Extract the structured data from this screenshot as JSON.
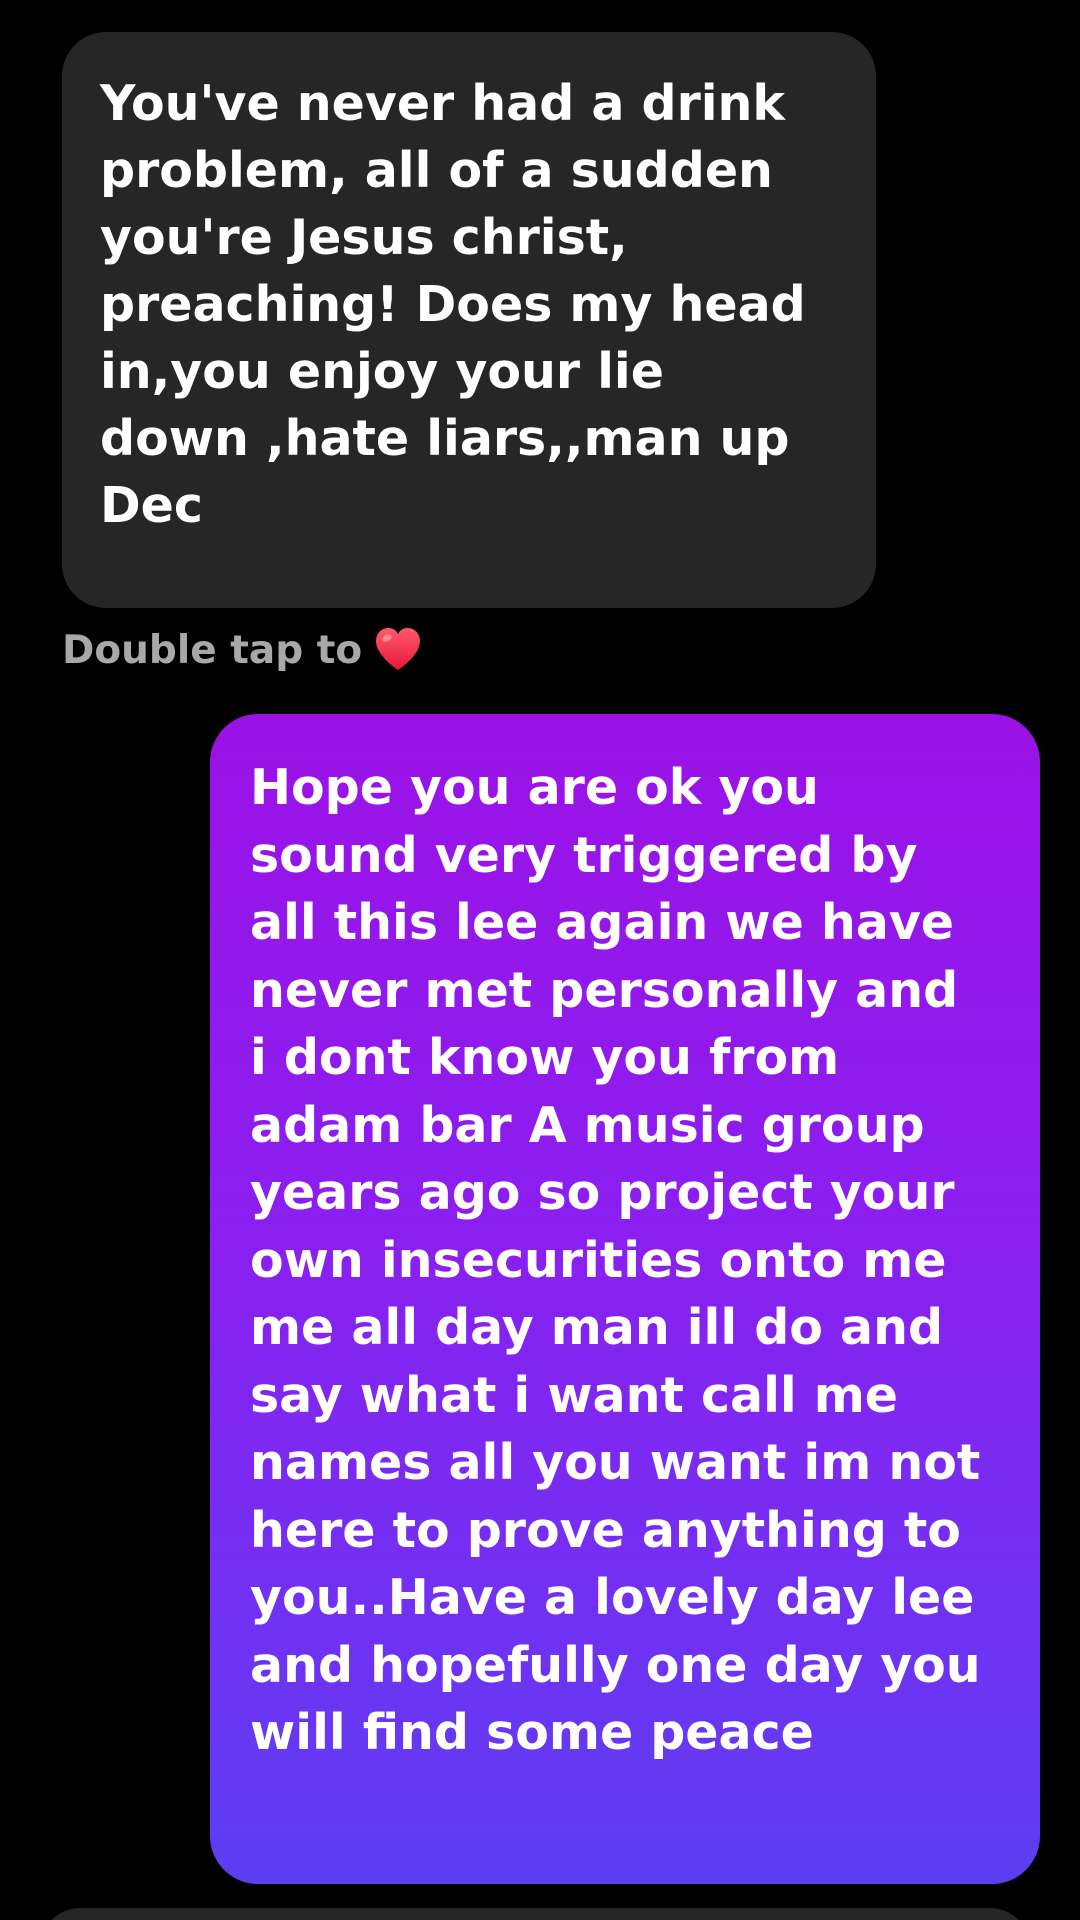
{
  "messages": [
    {
      "direction": "incoming",
      "text": "You've never had a drink\nproblem, all of a sudden\nyou're Jesus christ,\npreaching!  Does my head\nin,you enjoy your lie\ndown  ,hate liars,,man up\nDec"
    },
    {
      "direction": "outgoing",
      "text": "Hope you are ok you\nsound very triggered by\nall this lee again we have\nnever met personally and\ni dont know you from\nadam bar A music group\nyears ago so project your\nown insecurities onto me\nme all day man ill do and\nsay what i want call me\nnames all you want im not\nhere to prove anything to\nyou..Have a lovely day lee\nand hopefully one day you\nwill find some peace"
    }
  ],
  "reaction_hint": {
    "label": "Double tap to",
    "icon": "heart-icon",
    "icon_color": "#ff3040"
  },
  "colors": {
    "background": "#000000",
    "incoming_bubble": "#262626",
    "outgoing_gradient_top": "#9b12e6",
    "outgoing_gradient_bottom": "#5b3ef2",
    "hint_text": "#a8a8a8"
  }
}
